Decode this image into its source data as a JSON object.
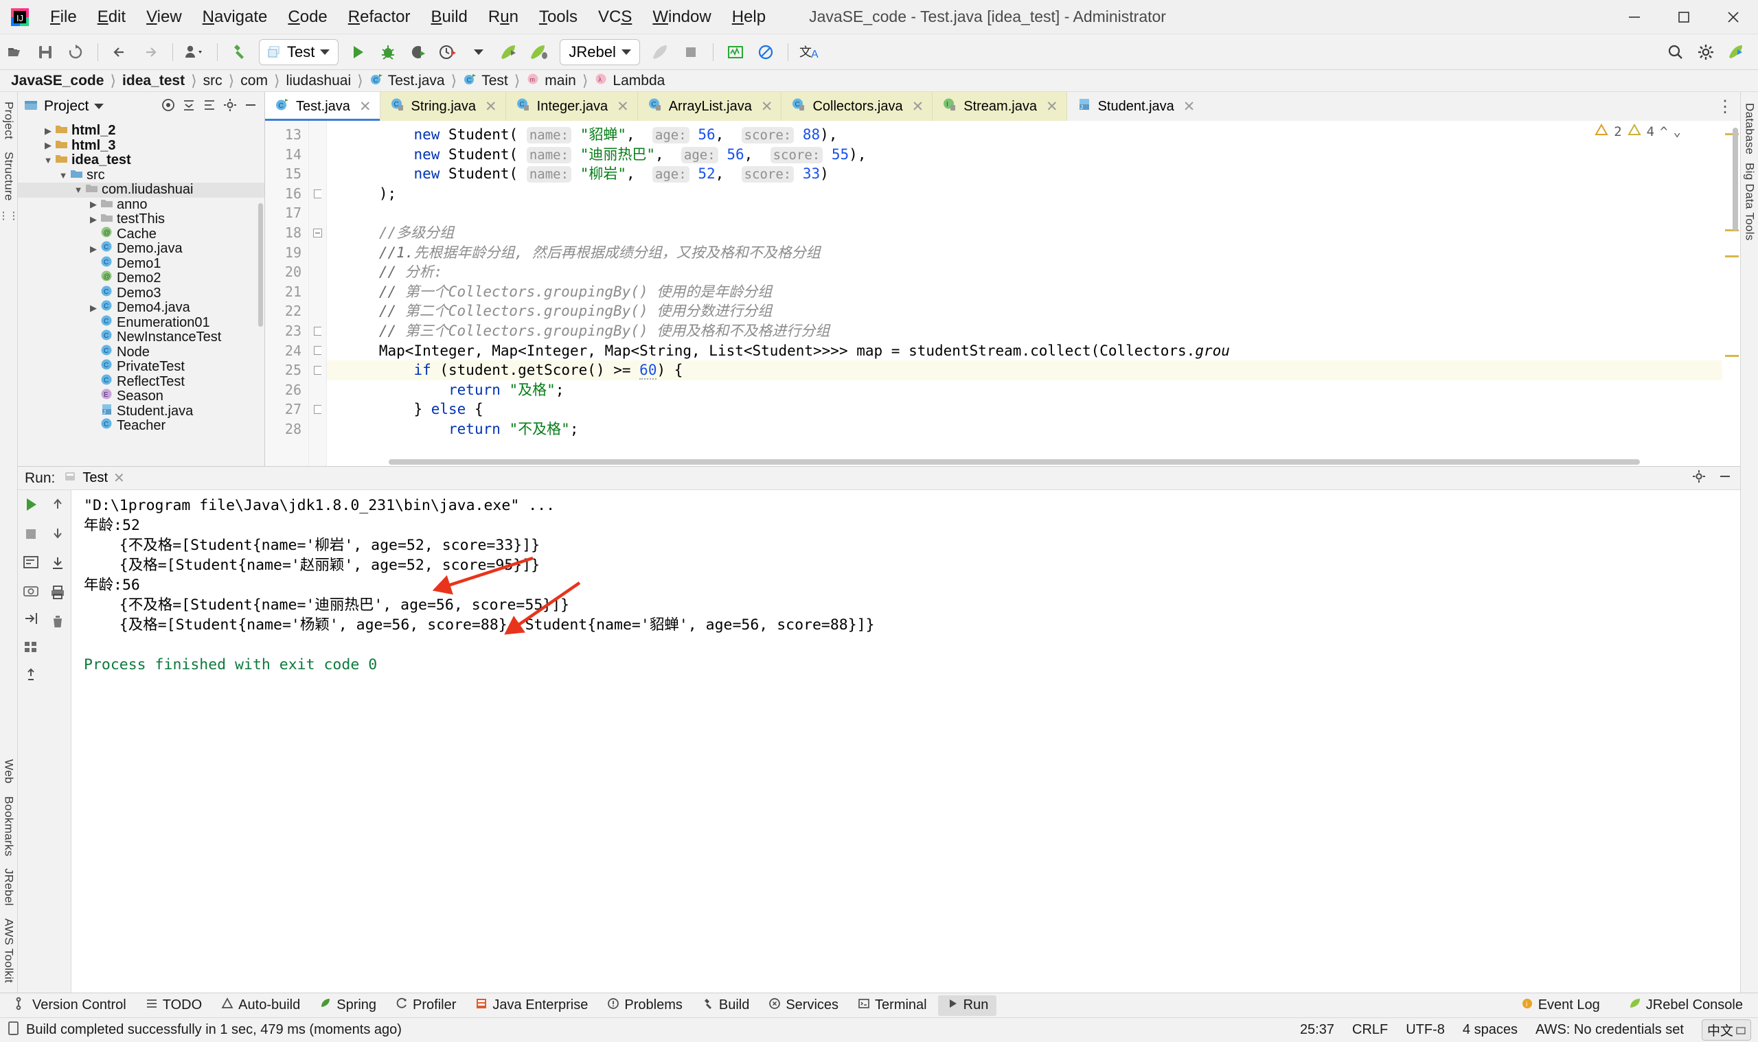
{
  "window": {
    "title": "JavaSE_code - Test.java [idea_test] - Administrator",
    "minimize": "minimize-button",
    "maximize": "maximize-button",
    "close": "close-button"
  },
  "menu": [
    {
      "pre": "",
      "mn": "F",
      "post": "ile"
    },
    {
      "pre": "",
      "mn": "E",
      "post": "dit"
    },
    {
      "pre": "",
      "mn": "V",
      "post": "iew"
    },
    {
      "pre": "",
      "mn": "N",
      "post": "avigate"
    },
    {
      "pre": "",
      "mn": "C",
      "post": "ode"
    },
    {
      "pre": "",
      "mn": "R",
      "post": "efactor"
    },
    {
      "pre": "",
      "mn": "B",
      "post": "uild"
    },
    {
      "pre": "R",
      "mn": "u",
      "post": "n"
    },
    {
      "pre": "",
      "mn": "T",
      "post": "ools"
    },
    {
      "pre": "VC",
      "mn": "S",
      "post": ""
    },
    {
      "pre": "",
      "mn": "W",
      "post": "indow"
    },
    {
      "pre": "",
      "mn": "H",
      "post": "elp"
    }
  ],
  "toolbar": {
    "run_config": "Test",
    "jrebel_config": "JRebel",
    "icons": [
      "open-folder-icon",
      "save-all-icon",
      "sync-icon",
      "navigate-back-icon",
      "navigate-forward-icon",
      "user-dropdown-icon",
      "build-hammer-icon",
      "run-icon",
      "debug-icon",
      "run-with-coverage-icon",
      "profiler-icon",
      "jrebel-run-icon",
      "jrebel-debug-icon",
      "jrebel-rocket-icon",
      "stop-icon",
      "monitor-icon",
      "block-icon",
      "translate-icon",
      "search-everywhere-icon",
      "settings-icon",
      "jrebel-play-icon"
    ]
  },
  "breadcrumbs": [
    {
      "label": "JavaSE_code",
      "bold": true,
      "icon": ""
    },
    {
      "label": "idea_test",
      "bold": true,
      "icon": ""
    },
    {
      "label": "src",
      "bold": false,
      "icon": ""
    },
    {
      "label": "com",
      "bold": false,
      "icon": ""
    },
    {
      "label": "liudashuai",
      "bold": false,
      "icon": ""
    },
    {
      "label": "Test.java",
      "bold": false,
      "icon": "class-icon"
    },
    {
      "label": "Test",
      "bold": false,
      "icon": "class-icon"
    },
    {
      "label": "main",
      "bold": false,
      "icon": "method-icon"
    },
    {
      "label": "Lambda",
      "bold": false,
      "icon": "lambda-icon"
    }
  ],
  "left_rail": {
    "top": [
      "Project",
      "Structure"
    ],
    "bottom": [
      "Web",
      "Bookmarks",
      "JRebel",
      "AWS Toolkit"
    ]
  },
  "right_rail": [
    "Database",
    "Big Data Tools"
  ],
  "project_panel": {
    "title": "Project",
    "header_icons": [
      "collapse-all-icon",
      "expand-all-icon",
      "settings-icon",
      "hide-icon",
      "target-icon"
    ],
    "tree": [
      {
        "indent": 1,
        "twist": "▶",
        "icon": "folder",
        "label": "html_2",
        "bold": true
      },
      {
        "indent": 1,
        "twist": "▶",
        "icon": "folder",
        "label": "html_3",
        "bold": true
      },
      {
        "indent": 1,
        "twist": "▼",
        "icon": "folder",
        "label": "idea_test",
        "bold": true
      },
      {
        "indent": 2,
        "twist": "▼",
        "icon": "folder",
        "label": "src",
        "bold": false
      },
      {
        "indent": 3,
        "twist": "▼",
        "icon": "package",
        "label": "com.liudashuai",
        "bold": false,
        "selected": true
      },
      {
        "indent": 4,
        "twist": "▶",
        "icon": "package",
        "label": "anno",
        "bold": false
      },
      {
        "indent": 4,
        "twist": "▶",
        "icon": "package",
        "label": "testThis",
        "bold": false
      },
      {
        "indent": 4,
        "twist": "",
        "icon": "annotation",
        "label": "Cache",
        "bold": false
      },
      {
        "indent": 4,
        "twist": "▶",
        "icon": "class",
        "label": "Demo.java",
        "bold": false
      },
      {
        "indent": 4,
        "twist": "",
        "icon": "class",
        "label": "Demo1",
        "bold": false
      },
      {
        "indent": 4,
        "twist": "",
        "icon": "annotation",
        "label": "Demo2",
        "bold": false
      },
      {
        "indent": 4,
        "twist": "",
        "icon": "class",
        "label": "Demo3",
        "bold": false
      },
      {
        "indent": 4,
        "twist": "▶",
        "icon": "class",
        "label": "Demo4.java",
        "bold": false
      },
      {
        "indent": 4,
        "twist": "",
        "icon": "class",
        "label": "Enumeration01",
        "bold": false
      },
      {
        "indent": 4,
        "twist": "",
        "icon": "class",
        "label": "NewInstanceTest",
        "bold": false
      },
      {
        "indent": 4,
        "twist": "",
        "icon": "class",
        "label": "Node",
        "bold": false
      },
      {
        "indent": 4,
        "twist": "",
        "icon": "class",
        "label": "PrivateTest",
        "bold": false
      },
      {
        "indent": 4,
        "twist": "",
        "icon": "class",
        "label": "ReflectTest",
        "bold": false
      },
      {
        "indent": 4,
        "twist": "",
        "icon": "enum",
        "label": "Season",
        "bold": false
      },
      {
        "indent": 4,
        "twist": "",
        "icon": "java",
        "label": "Student.java",
        "bold": false
      },
      {
        "indent": 4,
        "twist": "",
        "icon": "class",
        "label": "Teacher",
        "bold": false
      }
    ]
  },
  "editor_tabs": [
    {
      "label": "Test.java",
      "icon": "class-icon",
      "active": true,
      "locked": false
    },
    {
      "label": "String.java",
      "icon": "class-icon",
      "active": false,
      "locked": true
    },
    {
      "label": "Integer.java",
      "icon": "class-icon",
      "active": false,
      "locked": true
    },
    {
      "label": "ArrayList.java",
      "icon": "class-icon",
      "active": false,
      "locked": true
    },
    {
      "label": "Collectors.java",
      "icon": "class-icon",
      "active": false,
      "locked": true
    },
    {
      "label": "Stream.java",
      "icon": "interface-icon",
      "active": false,
      "locked": true
    },
    {
      "label": "Student.java",
      "icon": "java-file-icon",
      "active": false,
      "locked": false
    }
  ],
  "inspections": {
    "warnings": "2",
    "weak_warnings": "4"
  },
  "editor": {
    "first_line": 13,
    "lines": [
      {
        "n": 13,
        "indent": 0
      },
      {
        "n": 14,
        "indent": 0
      },
      {
        "n": 15,
        "indent": 0
      },
      {
        "n": 16,
        "indent": 0
      },
      {
        "n": 17,
        "indent": 0
      },
      {
        "n": 18,
        "indent": 0
      },
      {
        "n": 19,
        "indent": 0
      },
      {
        "n": 20,
        "indent": 0
      },
      {
        "n": 21,
        "indent": 0
      },
      {
        "n": 22,
        "indent": 0
      },
      {
        "n": 23,
        "indent": 0
      },
      {
        "n": 24,
        "indent": 0
      },
      {
        "n": 25,
        "indent": 0
      },
      {
        "n": 26,
        "indent": 0
      },
      {
        "n": 27,
        "indent": 0
      },
      {
        "n": 28,
        "indent": 0
      }
    ],
    "code_text": {
      "l13_new": "new",
      "l13_cls": " Student(",
      "l13_h1": "name:",
      "l13_s1": "\"貂蝉\"",
      "l13_h2": "age:",
      "l13_n2": "56",
      "l13_h3": "score:",
      "l13_n3": "88",
      "l13_tail": "),",
      "l14_s1": "\"迪丽热巴\"",
      "l14_n2": "56",
      "l14_n3": "55",
      "l15_s1": "\"柳岩\"",
      "l15_n2": "52",
      "l15_n3": "33",
      "l15_tail": ")",
      "l16": ");",
      "l18": "//多级分组",
      "l19a": "//1.",
      "l19b": "先根据年龄分组, 然后再根据成绩分组，又按及格和不及格分组",
      "l20a": "// ",
      "l20b": "分析:",
      "l21a": "// ",
      "l21b": "第一个Collectors.groupingBy()",
      "l21c": "使用的是年龄分组",
      "l22a": "// ",
      "l22b": "第二个Collectors.groupingBy()",
      "l22c": "使用分数进行分组",
      "l23a": "// ",
      "l23b": "第三个Collectors.groupingBy()",
      "l23c": "使用及格和不及格进行分组",
      "l24a": "Map<Integer, Map<Integer, Map<String, List<Student>>>> map = studentStream.collect(Collectors.",
      "l24b": "grou",
      "l25a": "if",
      "l25b": " (student.getScore() >= ",
      "l25c": "60",
      ".": "",
      "l25d": ") {",
      "l26a": "return",
      "l26b": "\"及格\"",
      "l26c": ";",
      "l27a": "} ",
      "l27b": "else",
      "l27c": " {",
      "l28a": "return",
      "l28b": "\"不及格\"",
      "l28c": ";"
    }
  },
  "run_panel": {
    "label": "Run:",
    "tab": "Test",
    "tab_icon": "run-tab-icon",
    "settings_icon": "gear-icon",
    "minimize_icon": "minimize-icon",
    "rail_icons": [
      "rerun-icon",
      "stop-icon",
      "up-icon",
      "down-icon",
      "soft-wrap-icon",
      "scroll-to-end-icon",
      "camera-icon",
      "print-icon",
      "clear-all-icon",
      "export-icon",
      "delete-icon",
      "grid-icon",
      "pin-icon"
    ],
    "console": [
      {
        "text": "\"D:\\1program file\\Java\\jdk1.8.0_231\\bin\\java.exe\" ...",
        "style": "cmd",
        "indent": 0
      },
      {
        "text": "年龄:52",
        "style": "plain",
        "indent": 0
      },
      {
        "text": "    {不及格=[Student{name='柳岩', age=52, score=33}]}",
        "style": "plain",
        "indent": 0
      },
      {
        "text": "    {及格=[Student{name='赵丽颖', age=52, score=95}]}",
        "style": "plain",
        "indent": 0
      },
      {
        "text": "年龄:56",
        "style": "plain",
        "indent": 0
      },
      {
        "text": "    {不及格=[Student{name='迪丽热巴', age=56, score=55}]}",
        "style": "plain",
        "indent": 0
      },
      {
        "text": "    {及格=[Student{name='杨颖', age=56, score=88}, Student{name='貂蝉', age=56, score=88}]}",
        "style": "plain",
        "indent": 0
      },
      {
        "text": "",
        "style": "plain",
        "indent": 0
      },
      {
        "text": "Process finished with exit code 0",
        "style": "ok",
        "indent": 0
      }
    ]
  },
  "tool_windows": [
    {
      "label": "Version Control",
      "icon": "branch-icon",
      "active": false
    },
    {
      "label": "TODO",
      "icon": "list-icon",
      "active": false
    },
    {
      "label": "Auto-build",
      "icon": "warning-icon",
      "active": false
    },
    {
      "label": "Spring",
      "icon": "spring-leaf-icon",
      "active": false
    },
    {
      "label": "Profiler",
      "icon": "profiler-icon",
      "active": false
    },
    {
      "label": "Java Enterprise",
      "icon": "java-ee-icon",
      "active": false
    },
    {
      "label": "Problems",
      "icon": "problems-icon",
      "active": false
    },
    {
      "label": "Build",
      "icon": "hammer-icon",
      "active": false
    },
    {
      "label": "Services",
      "icon": "services-icon",
      "active": false
    },
    {
      "label": "Terminal",
      "icon": "terminal-icon",
      "active": false
    },
    {
      "label": "Run",
      "icon": "run-icon",
      "active": true
    }
  ],
  "tool_windows_right": [
    {
      "label": "Event Log",
      "icon": "event-log-icon"
    },
    {
      "label": "JRebel Console",
      "icon": "jrebel-icon"
    }
  ],
  "status_bar": {
    "message": "Build completed successfully in 1 sec, 479 ms (moments ago)",
    "message_icon": "build-status-icon",
    "caret": "25:37",
    "line_sep": "CRLF",
    "encoding": "UTF-8",
    "indent": "4 spaces",
    "aws": "AWS: No credentials set",
    "ime": "中文"
  },
  "colors": {
    "accent_blue": "#3b7cd8",
    "keyword": "#0033b3",
    "string": "#067d17",
    "number": "#1750eb",
    "comment": "#8c8c8c",
    "tab_inactive": "#eeeec8",
    "console_cmd_bg": "#e9f5e1",
    "arrow_red": "#e8341c",
    "caret_line": "#fcfbeb"
  }
}
